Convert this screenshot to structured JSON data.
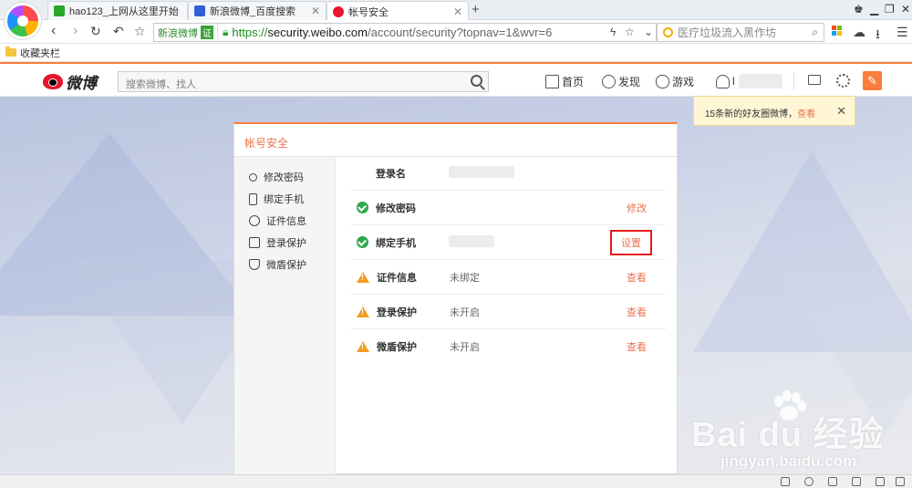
{
  "browser": {
    "tabs": [
      {
        "title": "hao123_上网从这里开始",
        "active": false,
        "favicon_color": "#2aa82a"
      },
      {
        "title": "新浪微博_百度搜索",
        "active": false,
        "favicon_color": "#2f5fd6"
      },
      {
        "title": "帐号安全",
        "active": true,
        "favicon_color": "#e6162d"
      }
    ],
    "new_tab_label": "+",
    "address_bar": {
      "site_tag": "新浪微博",
      "verified_badge": "证",
      "url_scheme": "https://",
      "url_host": "security.weibo.com",
      "url_path": "/account/security?topnav=1&wvr=6"
    },
    "search_box": {
      "placeholder": "医疗垃圾流入黑作坊"
    },
    "favorites_bar": {
      "label": "收藏夹栏"
    }
  },
  "weibo": {
    "logo_text": "微博",
    "search_placeholder": "搜索微博、找人",
    "nav": {
      "home": "首页",
      "discover": "发现",
      "games": "游戏",
      "user_initial": "l"
    },
    "notification": {
      "text": "15条新的好友圈微博，",
      "link": "查看",
      "close": "✕"
    },
    "panel": {
      "title": "帐号安全",
      "sidebar": [
        {
          "label": "修改密码",
          "icon": "key-icon"
        },
        {
          "label": "绑定手机",
          "icon": "phone-icon"
        },
        {
          "label": "证件信息",
          "icon": "id-card-icon"
        },
        {
          "label": "登录保护",
          "icon": "login-protect-icon"
        },
        {
          "label": "微盾保护",
          "icon": "shield-icon"
        }
      ],
      "rows": [
        {
          "label": "登录名",
          "status": "none",
          "value": "",
          "action": ""
        },
        {
          "label": "修改密码",
          "status": "ok",
          "value": "",
          "action": "修改"
        },
        {
          "label": "绑定手机",
          "status": "ok",
          "value": "",
          "action": "设置"
        },
        {
          "label": "证件信息",
          "status": "warning",
          "value": "未绑定",
          "action": "查看"
        },
        {
          "label": "登录保护",
          "status": "warning",
          "value": "未开启",
          "action": "查看"
        },
        {
          "label": "微盾保护",
          "status": "warning",
          "value": "未开启",
          "action": "查看"
        }
      ]
    }
  },
  "watermark": {
    "brand": "Bai du 经验",
    "url": "jingyan.baidu.com"
  },
  "colors": {
    "accent": "#fa7d3c",
    "link": "#eb7350",
    "ok": "#2fa84a",
    "warning": "#f29c1f",
    "highlight_box": "#e31c1c"
  }
}
